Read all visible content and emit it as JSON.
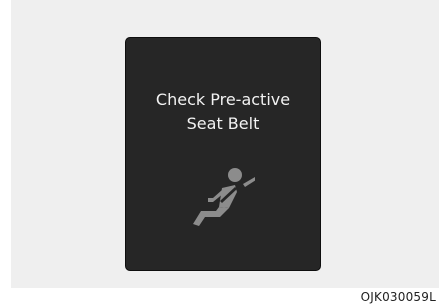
{
  "display": {
    "message_line1": "Check Pre-active",
    "message_line2": "Seat Belt",
    "icon": "seat-belt-warning-icon",
    "icon_color": "#8c8c8c",
    "screen_color": "#262626",
    "text_color": "#f2f2f2"
  },
  "figure": {
    "code": "OJK030059L"
  }
}
